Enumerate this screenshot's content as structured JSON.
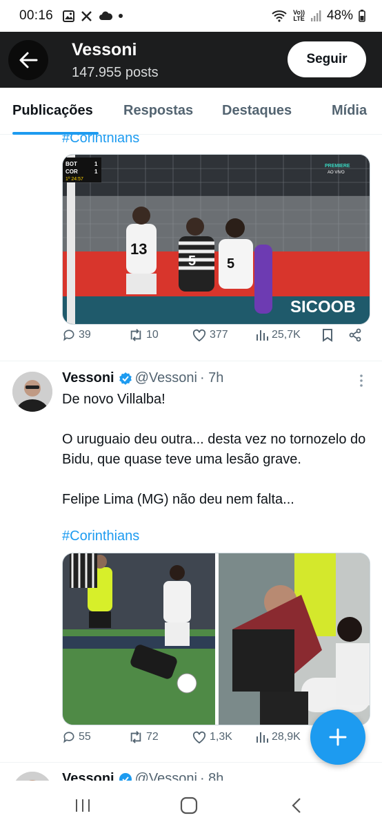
{
  "status_bar": {
    "time": "00:16",
    "network": "VoLTE",
    "battery": "48%"
  },
  "header": {
    "name": "Vessoni",
    "posts": "147.955 posts",
    "follow_label": "Seguir"
  },
  "tabs": [
    "Publicações",
    "Respostas",
    "Destaques",
    "Mídia"
  ],
  "post1": {
    "hashtag": "#Corinthians",
    "scoreboard": {
      "team1": "BOT",
      "team2": "COR",
      "score1": "1",
      "score2": "1",
      "clock": "1º 24:57",
      "broadcaster": "PREMIERE",
      "live": "AO VIVO"
    },
    "ad_text": "SICOOB",
    "jersey_numbers": [
      "13",
      "5",
      "5"
    ],
    "replies": "39",
    "reposts": "10",
    "likes": "377",
    "views": "25,7K"
  },
  "post2": {
    "name": "Vessoni",
    "handle": "@Vessoni",
    "time": "· 7h",
    "line1": "De novo Villalba!",
    "line2": "O uruguaio deu outra... desta vez no tornozelo do Bidu, que quase teve uma lesão grave.",
    "line3": "Felipe Lima (MG) não deu nem falta...",
    "hashtag": "#Corinthians",
    "replies": "55",
    "reposts": "72",
    "likes": "1,3K",
    "views": "28,9K"
  },
  "post3": {
    "name": "Vessoni",
    "handle": "@Vessoni",
    "time": "· 8h"
  },
  "colors": {
    "accent": "#1d9bf0",
    "header_bg": "#1c1d1e",
    "verified": "#1d9bf0"
  }
}
